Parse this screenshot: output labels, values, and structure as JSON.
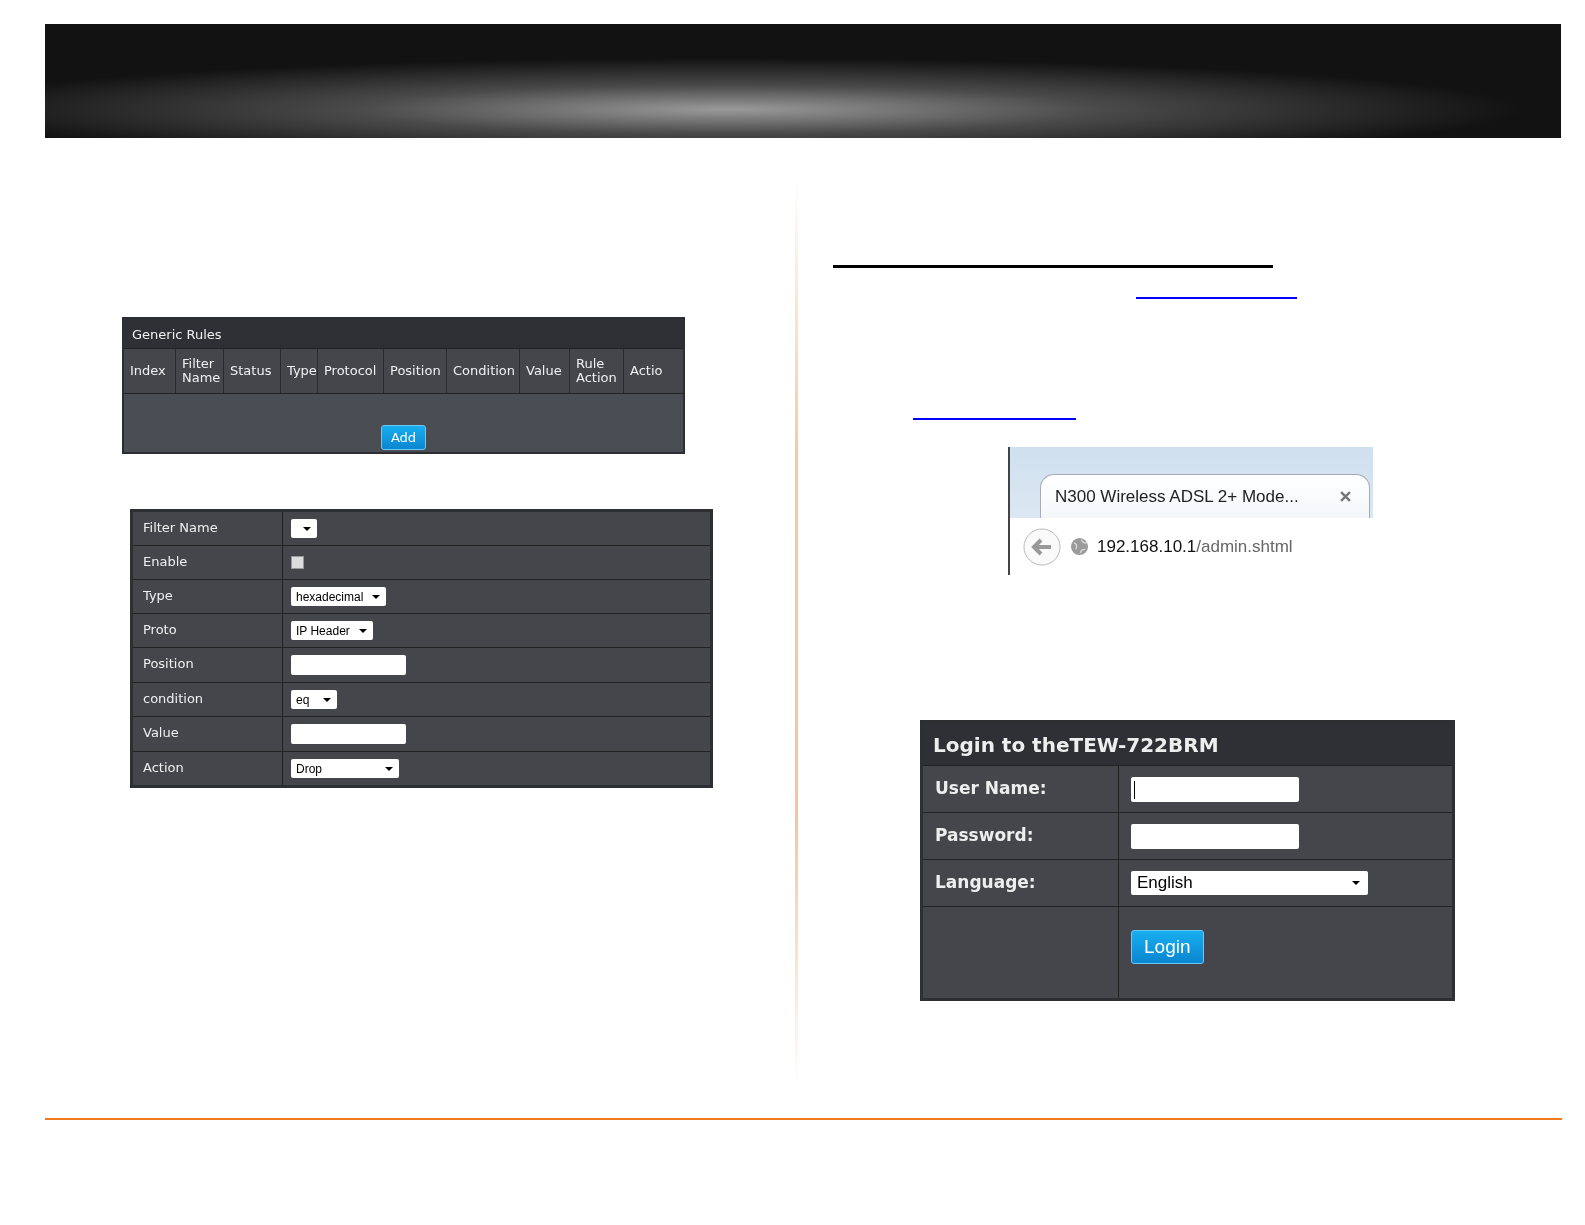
{
  "generic_rules": {
    "title": "Generic Rules",
    "columns": [
      "Index",
      "Filter Name",
      "Status",
      "Type",
      "Protocol",
      "Position",
      "Condition",
      "Value",
      "Rule Action",
      "Actio"
    ],
    "add_button": "Add"
  },
  "filter_form": {
    "rows": [
      {
        "label": "Filter Name",
        "kind": "select",
        "value": ""
      },
      {
        "label": "Enable",
        "kind": "checkbox",
        "checked": false
      },
      {
        "label": "Type",
        "kind": "select",
        "value": "hexadecimal"
      },
      {
        "label": "Proto",
        "kind": "select",
        "value": "IP Header"
      },
      {
        "label": "Position",
        "kind": "input",
        "value": ""
      },
      {
        "label": "condition",
        "kind": "select",
        "value": "eq"
      },
      {
        "label": "Value",
        "kind": "input",
        "value": ""
      },
      {
        "label": "Action",
        "kind": "select",
        "value": "Drop"
      }
    ]
  },
  "browser": {
    "tab_title": "N300 Wireless ADSL 2+ Mode...",
    "url_host": "192.168.10.1",
    "url_path": "/admin.shtml"
  },
  "login": {
    "title": "Login to theTEW-722BRM",
    "rows": [
      {
        "label": "User Name:",
        "kind": "input",
        "value": "",
        "focused": true
      },
      {
        "label": "Password:",
        "kind": "input",
        "value": "",
        "focused": false
      },
      {
        "label": "Language:",
        "kind": "select",
        "value": "English"
      }
    ],
    "button": "Login"
  }
}
